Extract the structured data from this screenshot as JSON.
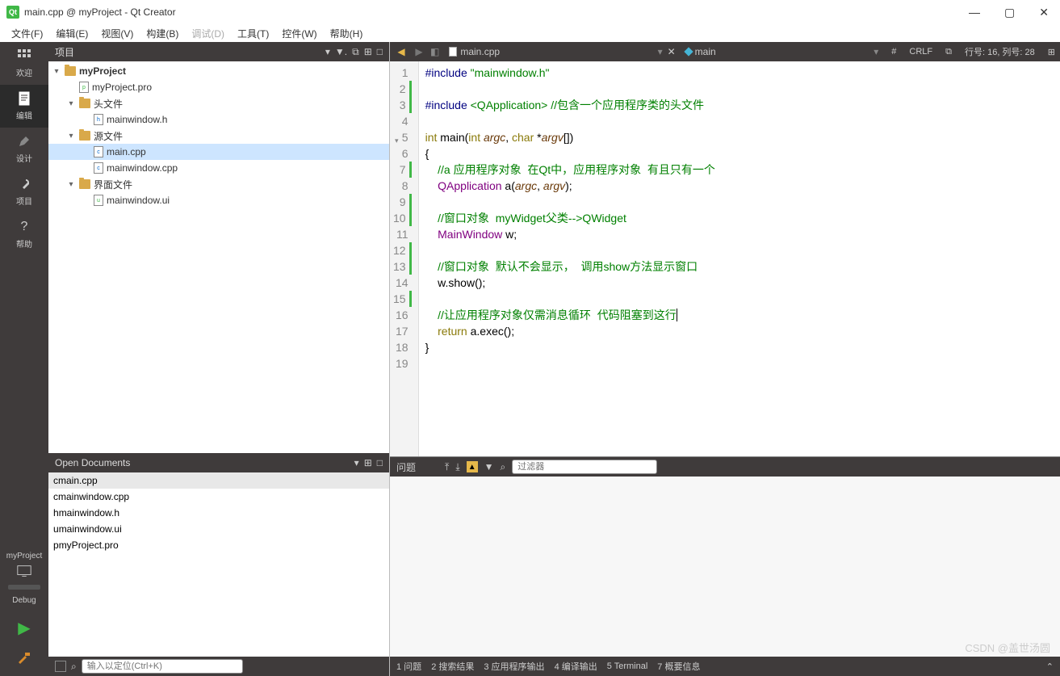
{
  "title": "main.cpp @ myProject - Qt Creator",
  "menubar": [
    "文件(F)",
    "编辑(E)",
    "视图(V)",
    "构建(B)",
    "调试(D)",
    "工具(T)",
    "控件(W)",
    "帮助(H)"
  ],
  "menubar_disabled_idx": 4,
  "leftrail": {
    "welcome": "欢迎",
    "edit": "编辑",
    "design": "设计",
    "projects": "项目",
    "help": "帮助",
    "project_name": "myProject",
    "debug": "Debug"
  },
  "project_panel": {
    "title": "项目",
    "tree": [
      {
        "depth": 0,
        "arrow": "▾",
        "icon": "folder",
        "label": "myProject",
        "bold": true
      },
      {
        "depth": 1,
        "arrow": "",
        "icon": "pro",
        "label": "myProject.pro"
      },
      {
        "depth": 1,
        "arrow": "▾",
        "icon": "folder",
        "label": "头文件"
      },
      {
        "depth": 2,
        "arrow": "",
        "icon": "h",
        "label": "mainwindow.h"
      },
      {
        "depth": 1,
        "arrow": "▾",
        "icon": "folder",
        "label": "源文件"
      },
      {
        "depth": 2,
        "arrow": "",
        "icon": "cpp",
        "label": "main.cpp",
        "sel": true
      },
      {
        "depth": 2,
        "arrow": "",
        "icon": "cpp",
        "label": "mainwindow.cpp"
      },
      {
        "depth": 1,
        "arrow": "▾",
        "icon": "folder",
        "label": "界面文件"
      },
      {
        "depth": 2,
        "arrow": "",
        "icon": "ui",
        "label": "mainwindow.ui"
      }
    ]
  },
  "open_docs": {
    "title": "Open Documents",
    "items": [
      {
        "icon": "cpp",
        "label": "main.cpp",
        "sel": true
      },
      {
        "icon": "cpp",
        "label": "mainwindow.cpp"
      },
      {
        "icon": "h",
        "label": "mainwindow.h"
      },
      {
        "icon": "ui",
        "label": "mainwindow.ui"
      },
      {
        "icon": "pro",
        "label": "myProject.pro"
      }
    ]
  },
  "locator": {
    "placeholder": "输入以定位(Ctrl+K)"
  },
  "editor_tab": {
    "file": "main.cpp",
    "symbol": "main",
    "indent": "#",
    "line_ending": "CRLF",
    "pos": "行号: 16, 列号: 28"
  },
  "code": {
    "lines": [
      {
        "n": 1,
        "mark": false,
        "html": "<span class='pp'>#include</span> <span class='str'>\"mainwindow.h\"</span>"
      },
      {
        "n": 2,
        "mark": true,
        "html": ""
      },
      {
        "n": 3,
        "mark": true,
        "html": "<span class='pp'>#include</span> <span class='str'>&lt;QApplication&gt;</span> <span class='cm'>//包含一个应用程序类的头文件</span>"
      },
      {
        "n": 4,
        "mark": false,
        "html": ""
      },
      {
        "n": 5,
        "mark": false,
        "fold": "▾",
        "html": "<span class='kw'>int</span> <span class='fn'>main</span>(<span class='kw'>int</span> <span class='arg'>argc</span>, <span class='kw'>char</span> *<span class='arg'>argv</span>[])"
      },
      {
        "n": 6,
        "mark": false,
        "html": "{"
      },
      {
        "n": 7,
        "mark": true,
        "html": "    <span class='cm'>//a 应用程序对象  在Qt中，应用程序对象  有且只有一个</span>"
      },
      {
        "n": 8,
        "mark": false,
        "html": "    <span class='ty'>QApplication</span> <span class='fn'>a</span>(<span class='arg'>argc</span>, <span class='arg'>argv</span>);"
      },
      {
        "n": 9,
        "mark": true,
        "html": ""
      },
      {
        "n": 10,
        "mark": true,
        "html": "    <span class='cm'>//窗口对象  myWidget父类--&gt;QWidget</span>"
      },
      {
        "n": 11,
        "mark": false,
        "html": "    <span class='ty'>MainWindow</span> w;"
      },
      {
        "n": 12,
        "mark": true,
        "html": ""
      },
      {
        "n": 13,
        "mark": true,
        "html": "    <span class='cm'>//窗口对象  默认不会显示，  调用show方法显示窗口</span>"
      },
      {
        "n": 14,
        "mark": false,
        "html": "    w.<span class='fn'>show</span>();"
      },
      {
        "n": 15,
        "mark": true,
        "html": ""
      },
      {
        "n": 16,
        "mark": false,
        "html": "    <span class='cm'>//让应用程序对象仅需消息循环  代码阻塞到这行</span><span class='cursor'></span>"
      },
      {
        "n": 17,
        "mark": false,
        "html": "    <span class='kw'>return</span> a.<span class='fn'>exec</span>();"
      },
      {
        "n": 18,
        "mark": false,
        "html": "}"
      },
      {
        "n": 19,
        "mark": false,
        "html": ""
      }
    ]
  },
  "issues": {
    "title": "问题",
    "filter_ph": "过滤器"
  },
  "bottombar": [
    "1  问题",
    "2  搜索结果",
    "3  应用程序输出",
    "4  编译输出",
    "5  Terminal",
    "7  概要信息"
  ],
  "watermark": "CSDN @盖世汤圆"
}
